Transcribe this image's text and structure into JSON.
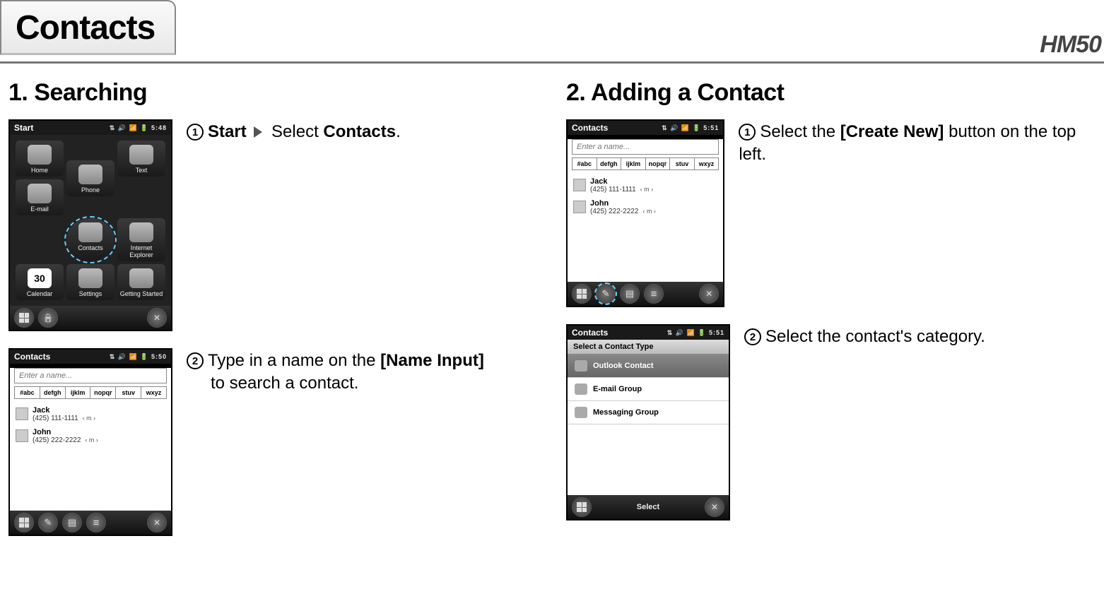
{
  "header": {
    "tab": "Contacts",
    "model": "HM50"
  },
  "left": {
    "title": "1. Searching",
    "step1": {
      "num": "1",
      "bold1": "Start",
      "plain": "Select",
      "bold2": "Contacts"
    },
    "step2": {
      "num": "2",
      "lead": "Type in a name on the",
      "bold": "[Name Input]",
      "tail": "to search a contact."
    }
  },
  "right": {
    "title": "2. Adding a Contact",
    "step1": {
      "num": "1",
      "lead": "Select the",
      "bold": "[Create New]",
      "tail": "button on the top left."
    },
    "step2": {
      "num": "2",
      "text": "Select the contact's category."
    }
  },
  "dev": {
    "time548": "5:48",
    "time550": "5:50",
    "time551": "5:51",
    "status_icons": "⇅ 🔊 📶 🔋",
    "start_title": "Start",
    "contacts_title": "Contacts",
    "apps": [
      "Home",
      "Text",
      "Phone",
      "E-mail",
      "Contacts",
      "Internet Explorer",
      "Calendar",
      "Getting Started",
      "Settings"
    ],
    "cal_day": "30",
    "search_placeholder": "Enter a name...",
    "alpha": [
      "#abc",
      "defgh",
      "ijklm",
      "nopqr",
      "stuv",
      "wxyz"
    ],
    "contacts": [
      {
        "name": "Jack",
        "phone": "(425) 111-1111",
        "tag": "‹ m ›"
      },
      {
        "name": "John",
        "phone": "(425) 222-2222",
        "tag": "‹ m ›"
      }
    ],
    "type_header": "Select a Contact Type",
    "types": [
      "Outlook Contact",
      "E-mail Group",
      "Messaging Group"
    ],
    "select_label": "Select"
  }
}
